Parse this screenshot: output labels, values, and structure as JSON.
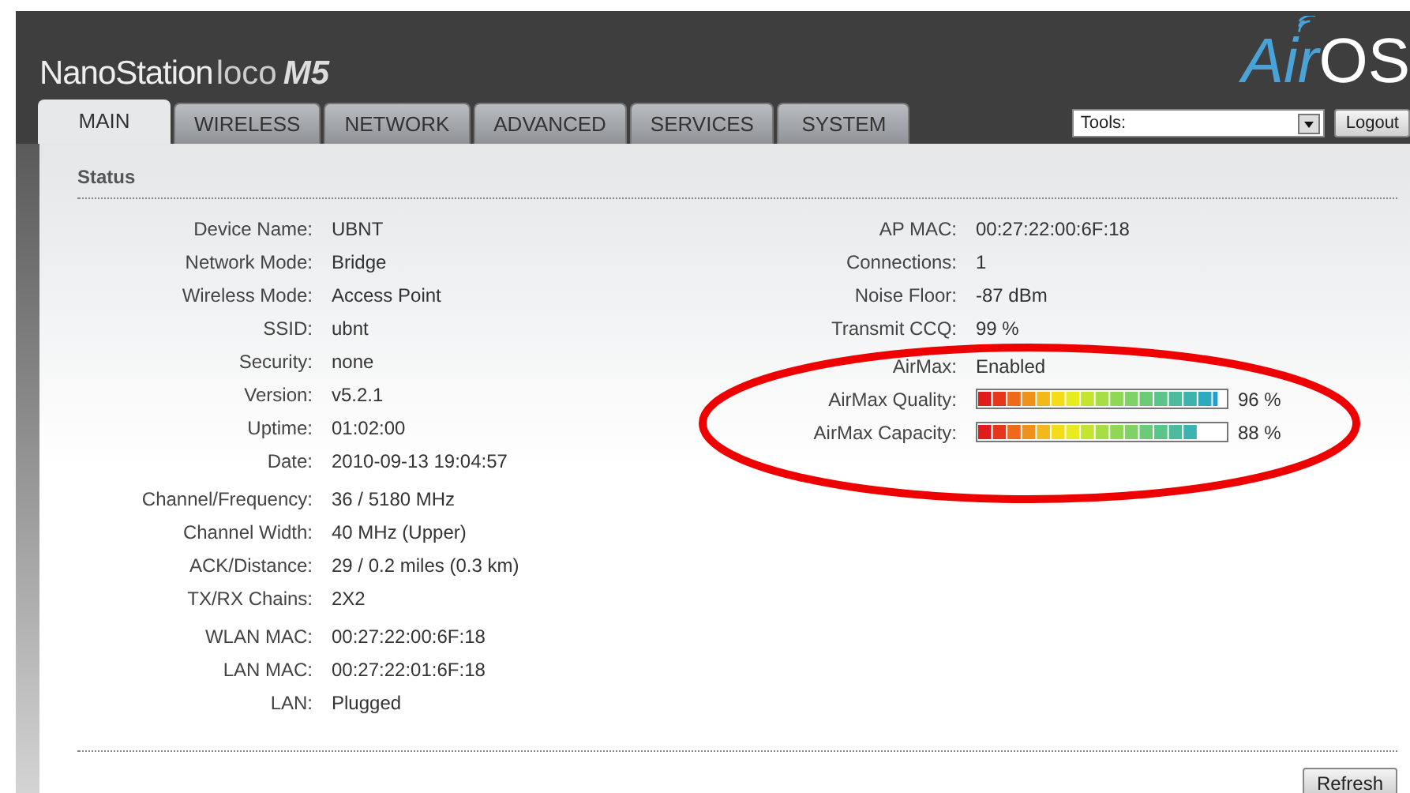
{
  "header": {
    "product": "NanoStation",
    "model": "loco",
    "version": "M5",
    "logo_main": "Air",
    "logo_suffix": "OS"
  },
  "tabs": [
    {
      "label": "MAIN",
      "selected": true
    },
    {
      "label": "WIRELESS",
      "selected": false
    },
    {
      "label": "NETWORK",
      "selected": false
    },
    {
      "label": "ADVANCED",
      "selected": false
    },
    {
      "label": "SERVICES",
      "selected": false
    },
    {
      "label": "SYSTEM",
      "selected": false
    }
  ],
  "tools": {
    "value": "Tools:",
    "logout": "Logout"
  },
  "section_title": "Status",
  "left_groups": [
    [
      {
        "label": "Device Name:",
        "value": "UBNT"
      },
      {
        "label": "Network Mode:",
        "value": "Bridge"
      },
      {
        "label": "Wireless Mode:",
        "value": "Access Point"
      },
      {
        "label": "SSID:",
        "value": "ubnt"
      },
      {
        "label": "Security:",
        "value": "none"
      },
      {
        "label": "Version:",
        "value": "v5.2.1"
      },
      {
        "label": "Uptime:",
        "value": "01:02:00"
      },
      {
        "label": "Date:",
        "value": "2010-09-13 19:04:57"
      }
    ],
    [
      {
        "label": "Channel/Frequency:",
        "value": "36 / 5180 MHz"
      },
      {
        "label": "Channel Width:",
        "value": "40 MHz (Upper)"
      },
      {
        "label": "ACK/Distance:",
        "value": "29 / 0.2 miles (0.3 km)"
      },
      {
        "label": "TX/RX Chains:",
        "value": "2X2"
      }
    ],
    [
      {
        "label": "WLAN MAC:",
        "value": "00:27:22:00:6F:18"
      },
      {
        "label": "LAN MAC:",
        "value": "00:27:22:01:6F:18"
      },
      {
        "label": "LAN:",
        "value": "Plugged"
      }
    ]
  ],
  "right_groups": [
    [
      {
        "kind": "text",
        "label": "AP MAC:",
        "value": "00:27:22:00:6F:18"
      },
      {
        "kind": "text",
        "label": "Connections:",
        "value": "1"
      },
      {
        "kind": "text",
        "label": "Noise Floor:",
        "value": "-87 dBm"
      },
      {
        "kind": "text",
        "label": "Transmit CCQ:",
        "value": "99 %"
      }
    ],
    [
      {
        "kind": "text",
        "label": "AirMax:",
        "value": "Enabled"
      },
      {
        "kind": "meter",
        "label": "AirMax Quality:",
        "level": 0.96,
        "reading": "96 %"
      },
      {
        "kind": "meter",
        "label": "AirMax Capacity:",
        "level": 0.88,
        "reading": "88 %"
      }
    ]
  ],
  "refresh": "Refresh"
}
